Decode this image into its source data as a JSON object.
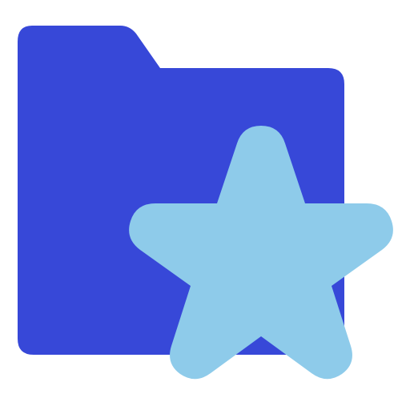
{
  "icon": {
    "name": "folder-star-icon",
    "parts": [
      "folder-icon",
      "star-icon"
    ]
  },
  "colors": {
    "background": "#ffffff",
    "folder": "#3748d8",
    "star": "#8ecbea"
  }
}
